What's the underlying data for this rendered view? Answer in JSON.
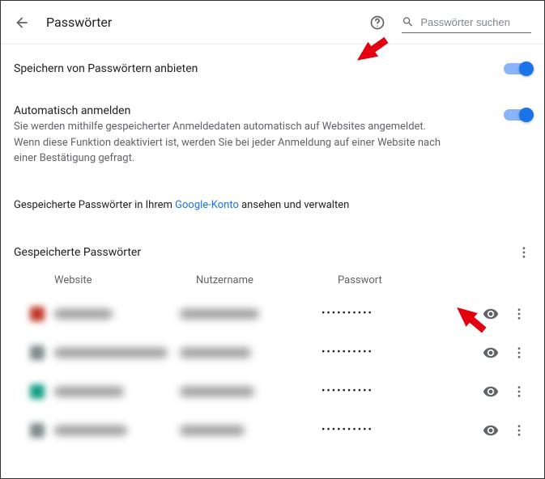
{
  "header": {
    "title": "Passwörter",
    "search_placeholder": "Passwörter suchen"
  },
  "settings": {
    "offer_save": {
      "label": "Speichern von Passwörtern anbieten",
      "enabled": true
    },
    "auto_signin": {
      "title": "Automatisch anmelden",
      "description": "Sie werden mithilfe gespeicherter Anmeldedaten automatisch auf Websites angemeldet. Wenn diese Funktion deaktiviert ist, werden Sie bei jeder Anmeldung auf einer Website nach einer Bestätigung gefragt.",
      "enabled": true
    },
    "manage": {
      "prefix": "Gespeicherte Passwörter in Ihrem ",
      "link_text": "Google-Konto",
      "suffix": " ansehen und verwalten"
    }
  },
  "passwords_section": {
    "title": "Gespeicherte Passwörter",
    "columns": {
      "website": "Website",
      "username": "Nutzername",
      "password": "Passwort"
    },
    "rows": [
      {
        "favicon_color": "#c0392b",
        "website_blur_w": 72,
        "user_blur_w": 98,
        "mask": "• • • • • • • • • •"
      },
      {
        "favicon_color": "#7f8c8d",
        "website_blur_w": 140,
        "user_blur_w": 88,
        "mask": "• • • • • • • • • •"
      },
      {
        "favicon_color": "#16a085",
        "website_blur_w": 86,
        "user_blur_w": 92,
        "mask": "• • • • • • • • • •"
      },
      {
        "favicon_color": "#7f8c8d",
        "website_blur_w": 90,
        "user_blur_w": 80,
        "mask": "• • • • • • • • • •"
      }
    ]
  }
}
